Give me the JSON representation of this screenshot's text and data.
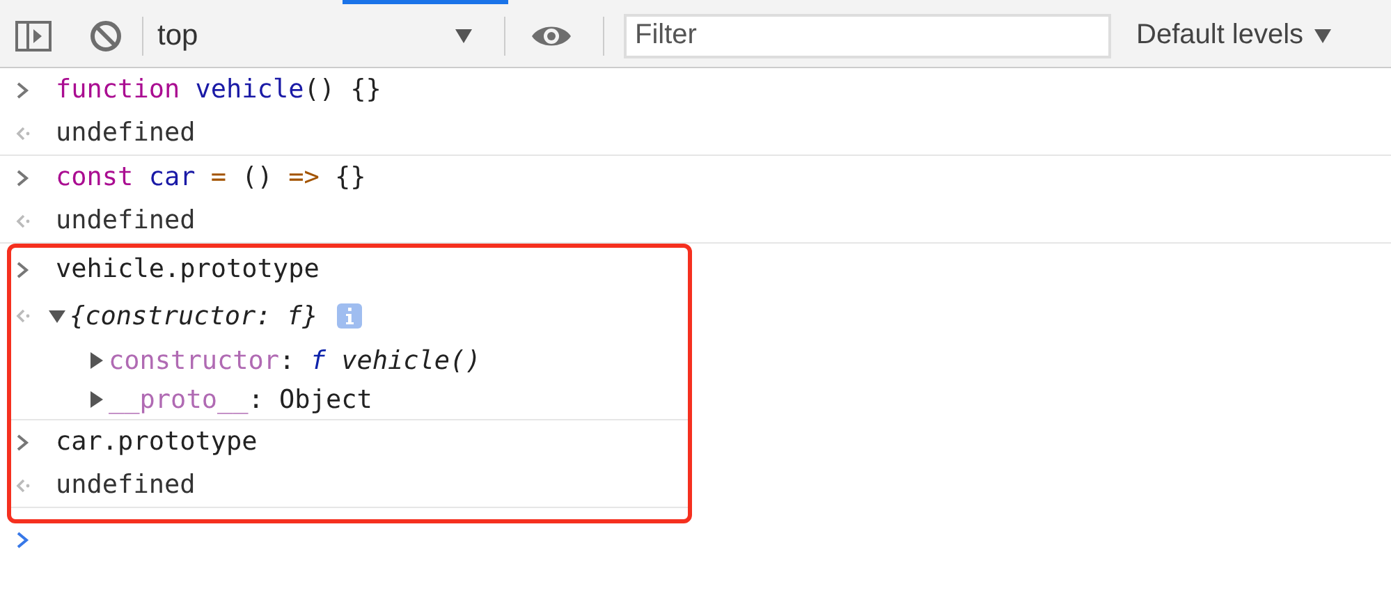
{
  "toolbar": {
    "context": "top",
    "filter": {
      "placeholder": "Filter"
    },
    "levels": "Default levels"
  },
  "groups": [
    {
      "highlighted": false,
      "commands": [
        {
          "input": [
            {
              "text": "function ",
              "kind": "keyword"
            },
            {
              "text": "vehicle",
              "kind": "name"
            },
            {
              "text": "() {}",
              "kind": "plain"
            }
          ],
          "result": {
            "kind": "text",
            "text": "undefined"
          }
        },
        {
          "input": [
            {
              "text": "const ",
              "kind": "keyword"
            },
            {
              "text": "car",
              "kind": "name"
            },
            {
              "text": " = ",
              "kind": "op"
            },
            {
              "text": "() ",
              "kind": "plain"
            },
            {
              "text": "=> ",
              "kind": "op"
            },
            {
              "text": "{}",
              "kind": "plain"
            }
          ],
          "result": {
            "kind": "text",
            "text": "undefined"
          }
        }
      ]
    },
    {
      "highlighted": true,
      "commands": [
        {
          "input": [
            {
              "text": "vehicle.prototype",
              "kind": "plain"
            }
          ],
          "result": {
            "kind": "object",
            "summary": "{constructor: f}",
            "expanded": true,
            "properties": [
              {
                "key": "constructor",
                "expanded": false,
                "value": [
                  {
                    "text": ": ",
                    "kind": "plain"
                  },
                  {
                    "text": "f",
                    "kind": "fn"
                  },
                  {
                    "text": " vehicle()",
                    "kind": "italic"
                  }
                ]
              },
              {
                "key": "__proto__",
                "expanded": false,
                "value": [
                  {
                    "text": ": Object",
                    "kind": "plain"
                  }
                ]
              }
            ]
          }
        },
        {
          "input": [
            {
              "text": "car.prototype",
              "kind": "plain"
            }
          ],
          "result": {
            "kind": "text",
            "text": "undefined"
          }
        }
      ]
    }
  ]
}
